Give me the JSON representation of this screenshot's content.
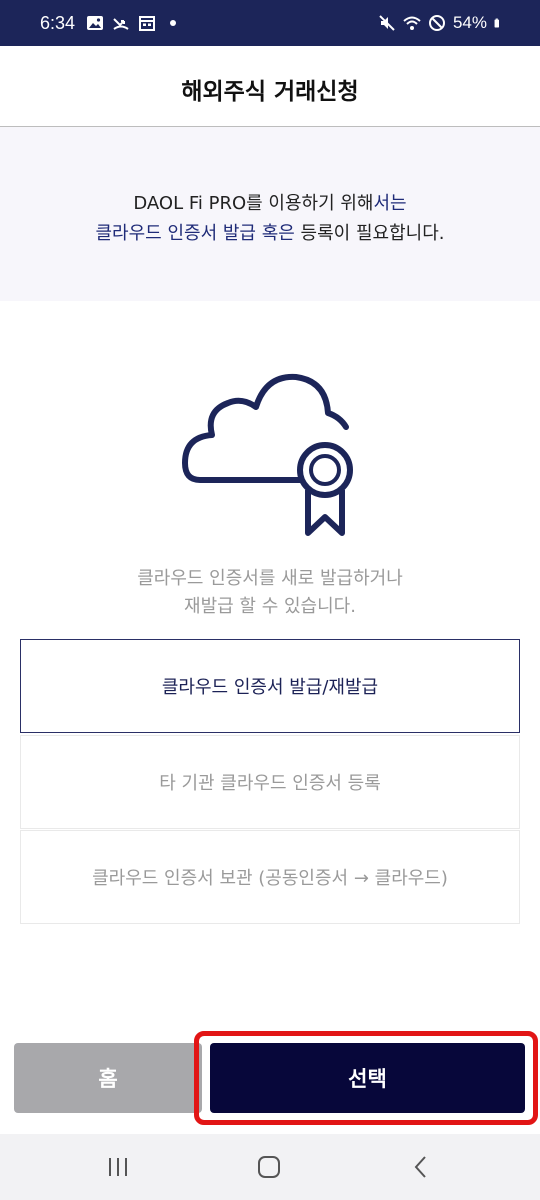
{
  "status_bar": {
    "time": "6:34",
    "battery": "54%",
    "left_icons": [
      "image-icon",
      "missed-call-icon",
      "calendar-icon",
      "dot-icon"
    ],
    "right_icons": [
      "mute-icon",
      "wifi-icon",
      "do-not-disturb-icon",
      "battery-icon"
    ]
  },
  "header": {
    "title": "해외주식 거래신청"
  },
  "notice": {
    "line1_a": "DAOL Fi PRO를 이용하기 위해",
    "line1_b": "서는",
    "line2_a": "클라우드 인증서 발급 혹은",
    "line2_b": " 등록이 필요합니다."
  },
  "illustration": {
    "icon": "cloud-certificate-icon"
  },
  "description": {
    "line1": "클라우드 인증서를 새로 발급하거나",
    "line2": "재발급 할 수 있습니다."
  },
  "options": [
    {
      "label": "클라우드 인증서 발급/재발급",
      "selected": true
    },
    {
      "label": "타 기관 클라우드 인증서 등록",
      "selected": false
    },
    {
      "label": "클라우드 인증서 보관 (공동인증서 → 클라우드)",
      "selected": false
    }
  ],
  "buttons": {
    "home_label": "홈",
    "select_label": "선택"
  },
  "nav_bar": {
    "icons": [
      "recent-apps-icon",
      "home-icon",
      "back-icon"
    ]
  },
  "colors": {
    "status_bar": "#1c2559",
    "accent_text": "#1f2b78",
    "primary_button": "#07073a",
    "secondary_button": "#a8a8ab",
    "highlight": "#e21515"
  }
}
